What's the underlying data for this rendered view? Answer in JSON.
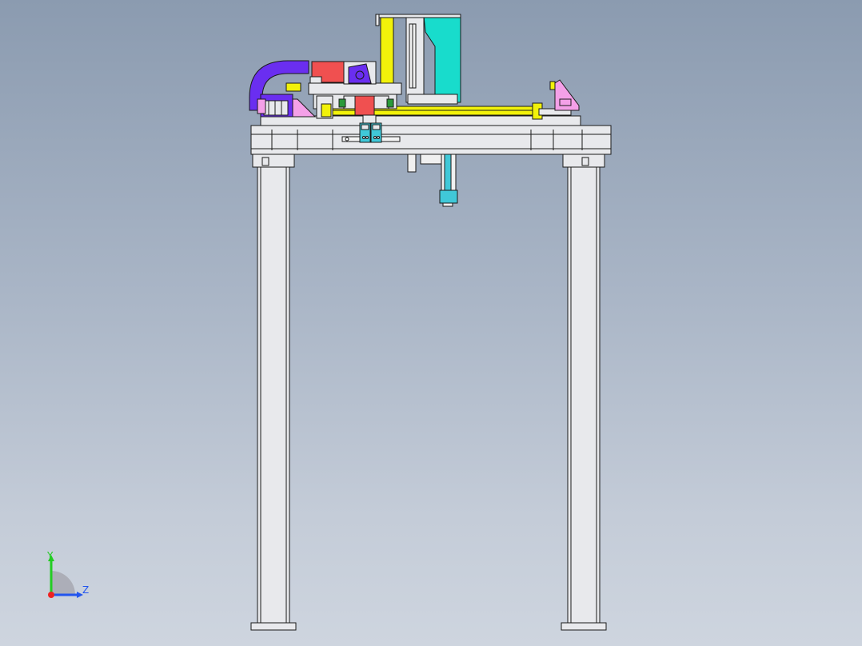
{
  "viewport": {
    "view": "front",
    "background_top": "#8b9bb0",
    "background_bottom": "#ced5df"
  },
  "model": {
    "name": "gantry-frame-assembly",
    "parts": [
      "left-column",
      "right-column",
      "top-beam",
      "linear-rail",
      "cable-chain",
      "servo-motor",
      "z-axis-plate",
      "z-axis-cylinder",
      "end-mounting-brackets",
      "carriage-block",
      "gripper-nozzle"
    ],
    "colors": {
      "frame": "#e8e9ec",
      "outline": "#1a1a1a",
      "rail": "#f2f20a",
      "cyan_plate": "#18dccc",
      "cable_chain": "#6a2ef0",
      "motor_housing": "#f05050",
      "bracket": "#f4a0e8",
      "teal_block": "#40c8d8",
      "green_bolt": "#2a9a3a"
    }
  },
  "triad": {
    "y_label": "Y",
    "z_label": "Z",
    "y_color": "#22cc22",
    "z_color": "#2255ee",
    "x_color": "#ee2222"
  }
}
